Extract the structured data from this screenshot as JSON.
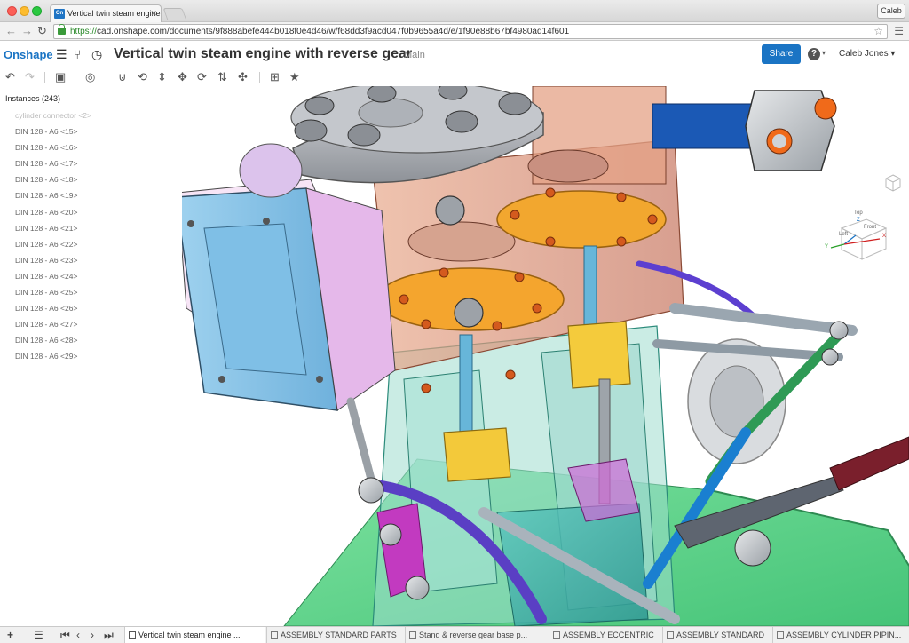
{
  "browser": {
    "tab_title": "Vertical twin steam engine",
    "tab_favicon": "On",
    "profile": "Caleb",
    "url_scheme": "https://",
    "url_rest": "cad.onshape.com/documents/9f888abefe444b018f0e4d46/w/f68dd3f9acd047f0b9655a4d/e/1f90e88b67bf4980ad14f601"
  },
  "app": {
    "logo": "Onshape",
    "document_title": "Vertical twin steam engine with reverse gear",
    "branch": "Main",
    "share_label": "Share",
    "help_label": "?",
    "user_label": "Caleb Jones"
  },
  "instances": {
    "header": "Instances (243)",
    "items": [
      "cylinder connector <2>",
      "DIN 128 - A6 <15>",
      "DIN 128 - A6 <16>",
      "DIN 128 - A6 <17>",
      "DIN 128 - A6 <18>",
      "DIN 128 - A6 <19>",
      "DIN 128 - A6 <20>",
      "DIN 128 - A6 <21>",
      "DIN 128 - A6 <22>",
      "DIN 128 - A6 <23>",
      "DIN 128 - A6 <24>",
      "DIN 128 - A6 <25>",
      "DIN 128 - A6 <26>",
      "DIN 128 - A6 <27>",
      "DIN 128 - A6 <28>",
      "DIN 128 - A6 <29>"
    ]
  },
  "viewcube": {
    "top": "Top",
    "left": "Left",
    "front": "Front",
    "axis_x": "X",
    "axis_y": "Y",
    "axis_z": "Z"
  },
  "bottom_tabs": [
    {
      "label": "Vertical twin steam engine ..."
    },
    {
      "label": "ASSEMBLY STANDARD PARTS"
    },
    {
      "label": "Stand & reverse gear base p..."
    },
    {
      "label": "ASSEMBLY ECCENTRIC"
    },
    {
      "label": "ASSEMBLY STANDARD"
    },
    {
      "label": "ASSEMBLY CYLINDER PIPIN..."
    }
  ],
  "colors": {
    "brand_blue": "#1a74c4",
    "ground_plate": "#5fd88a",
    "cylinder_orange": "#f4a33a",
    "cover_blue": "#8dc9ee"
  }
}
